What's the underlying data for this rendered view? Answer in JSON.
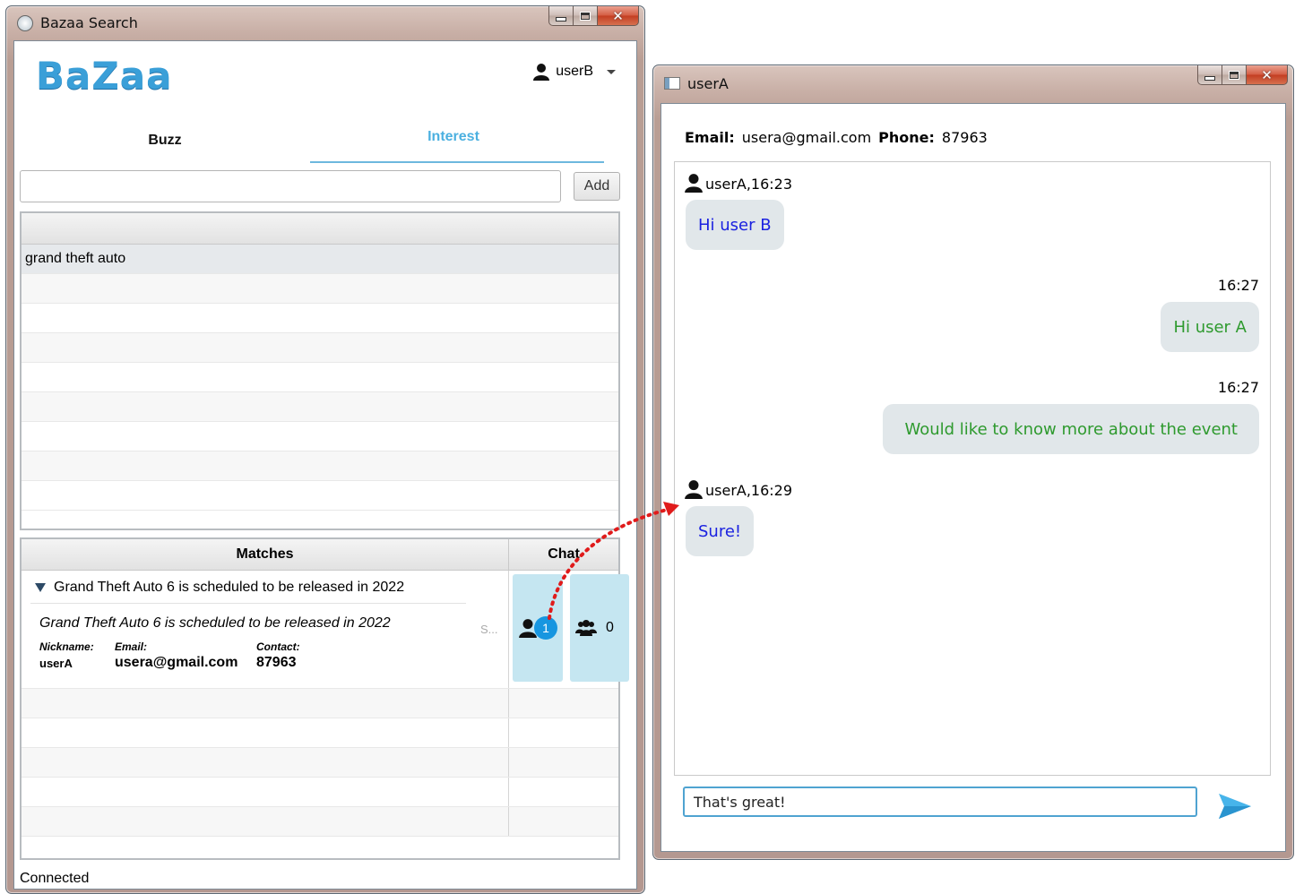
{
  "colors": {
    "accent": "#3a9fd8",
    "incoming_text": "#1b22e0",
    "outgoing_text": "#2e9a2e",
    "bubble_bg": "#e1e7ea",
    "chat_card_bg": "#c5e6f1",
    "badge_bg": "#1796e0"
  },
  "main_window": {
    "title": "Bazaa Search",
    "logo": "BaZaa",
    "user": "userB",
    "tabs": [
      {
        "label": "Buzz",
        "active": false
      },
      {
        "label": "Interest",
        "active": true
      }
    ],
    "add_label": "Add",
    "search_value": "",
    "interests": [
      "grand theft auto"
    ],
    "matches": {
      "col_matches": "Matches",
      "col_chat": "Chat",
      "item": {
        "title": "Grand Theft Auto 6 is scheduled to be released in 2022",
        "description": "Grand Theft Auto 6 is scheduled to be released in 2022",
        "source_abbr": "S...",
        "nickname_label": "Nickname:",
        "nickname": "userA",
        "email_label": "Email:",
        "email": "usera@gmail.com",
        "contact_label": "Contact:",
        "contact": "87963",
        "chat_unread": "1",
        "group_count": "0"
      }
    },
    "status": "Connected"
  },
  "chat_window": {
    "title": "userA",
    "email_label": "Email:",
    "email": "usera@gmail.com",
    "phone_label": "Phone:",
    "phone": "87963",
    "messages": [
      {
        "direction": "in",
        "sender": "userA,16:23",
        "text": "Hi user B"
      },
      {
        "direction": "out",
        "time": "16:27",
        "text": "Hi user A"
      },
      {
        "direction": "out",
        "time": "16:27",
        "text": "Would like to know more about the event"
      },
      {
        "direction": "in",
        "sender": "userA,16:29",
        "text": "Sure!"
      }
    ],
    "input_value": "That's great!"
  }
}
